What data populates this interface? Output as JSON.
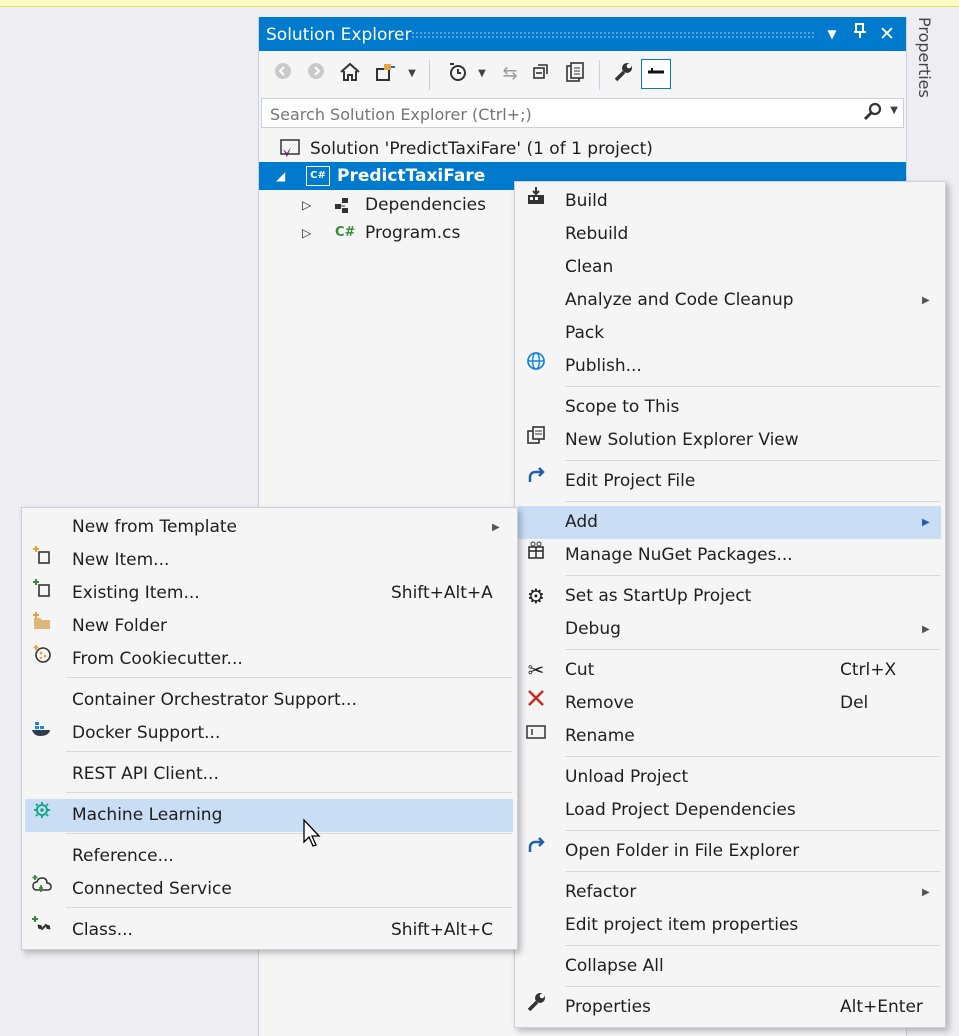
{
  "solution_explorer": {
    "title": "Solution Explorer",
    "search_placeholder": "Search Solution Explorer (Ctrl+;)",
    "tree": {
      "solution": "Solution 'PredictTaxiFare' (1 of 1 project)",
      "project": "PredictTaxiFare",
      "dependencies": "Dependencies",
      "program": "Program.cs",
      "project_icon_text": "C#",
      "program_icon_text": "C#"
    }
  },
  "properties_tab": "Properties",
  "context_menu": {
    "items": [
      {
        "label": "Build",
        "icon": "build-icon"
      },
      {
        "label": "Rebuild"
      },
      {
        "label": "Clean"
      },
      {
        "label": "Analyze and Code Cleanup",
        "submenu": true
      },
      {
        "label": "Pack"
      },
      {
        "label": "Publish...",
        "icon": "globe-icon"
      },
      {
        "label": "Scope to This"
      },
      {
        "label": "New Solution Explorer View",
        "icon": "new-view-icon"
      },
      {
        "label": "Edit Project File",
        "icon": "redo-arrow-icon"
      },
      {
        "label": "Add",
        "submenu": true,
        "highlighted": true
      },
      {
        "label": "Manage NuGet Packages...",
        "icon": "nuget-icon"
      },
      {
        "label": "Set as StartUp Project",
        "icon": "gear-icon"
      },
      {
        "label": "Debug",
        "submenu": true
      },
      {
        "label": "Cut",
        "shortcut": "Ctrl+X",
        "icon": "scissors-icon"
      },
      {
        "label": "Remove",
        "shortcut": "Del",
        "icon": "remove-x-icon"
      },
      {
        "label": "Rename",
        "icon": "rename-icon"
      },
      {
        "label": "Unload Project"
      },
      {
        "label": "Load Project Dependencies"
      },
      {
        "label": "Open Folder in File Explorer",
        "icon": "redo-arrow-icon"
      },
      {
        "label": "Refactor",
        "submenu": true
      },
      {
        "label": "Edit project item properties"
      },
      {
        "label": "Collapse All"
      },
      {
        "label": "Properties",
        "shortcut": "Alt+Enter",
        "icon": "wrench-icon"
      }
    ]
  },
  "add_submenu": {
    "items": [
      {
        "label": "New from Template",
        "submenu": true
      },
      {
        "label": "New Item...",
        "icon": "new-item-icon"
      },
      {
        "label": "Existing Item...",
        "shortcut": "Shift+Alt+A",
        "icon": "existing-item-icon"
      },
      {
        "label": "New Folder",
        "icon": "new-folder-icon"
      },
      {
        "label": "From Cookiecutter...",
        "icon": "cookiecutter-icon"
      },
      {
        "label": "Container Orchestrator Support..."
      },
      {
        "label": "Docker Support...",
        "icon": "docker-icon"
      },
      {
        "label": "REST API Client..."
      },
      {
        "label": "Machine Learning",
        "icon": "machine-learning-icon",
        "highlighted": true
      },
      {
        "label": "Reference..."
      },
      {
        "label": "Connected Service",
        "icon": "connected-service-icon"
      },
      {
        "label": "Class...",
        "shortcut": "Shift+Alt+C",
        "icon": "class-icon"
      }
    ]
  },
  "colors": {
    "accent": "#007acc",
    "menu_highlight": "#c9def5",
    "menu_bg": "#f5f5f5"
  }
}
